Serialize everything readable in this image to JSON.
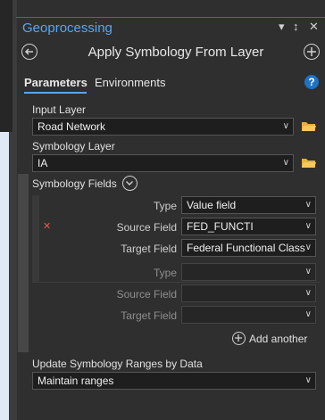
{
  "pane": {
    "title": "Geoprocessing",
    "tool_title": "Apply Symbology From Layer"
  },
  "tabs": {
    "parameters": "Parameters",
    "environments": "Environments"
  },
  "help": "?",
  "input_layer": {
    "label": "Input Layer",
    "value": "Road Network"
  },
  "symbology_layer": {
    "label": "Symbology Layer",
    "value": "IA"
  },
  "symbology_fields": {
    "label": "Symbology Fields",
    "type_label": "Type",
    "source_label": "Source Field",
    "target_label": "Target Field",
    "row1": {
      "type": "Value field",
      "source": "FED_FUNCTI",
      "target": "Federal Functional Class"
    },
    "row2": {
      "type": "",
      "source": "",
      "target": ""
    },
    "add_another": "Add another"
  },
  "update_ranges": {
    "label": "Update Symbology Ranges by Data",
    "value": "Maintain ranges"
  },
  "colors": {
    "accent": "#5aa6ee",
    "remove": "#e05a4a",
    "folder": "#e8b23a"
  }
}
